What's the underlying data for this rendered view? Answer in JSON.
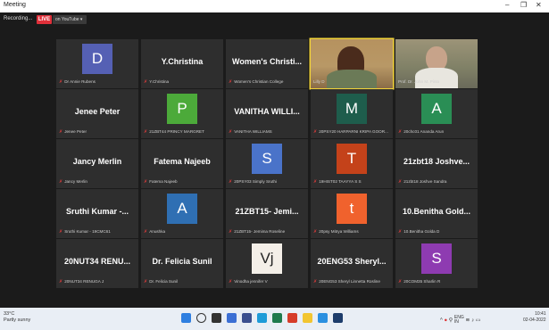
{
  "window": {
    "title": "Meeting"
  },
  "toolbar": {
    "recording_label": "Recording...",
    "live_label": "LIVE",
    "youtube_label": "on YouTube ▾"
  },
  "tiles": [
    {
      "avatar_letter": "D",
      "avatar_color": "#5560b4",
      "label": "Dr Annie Rubens",
      "muted": true
    },
    {
      "name": "Y.Christina",
      "label": "Y.Christina",
      "muted": true
    },
    {
      "name": "Women's Christi...",
      "label": "Women's Christian College",
      "muted": true
    },
    {
      "video": true,
      "label": "Lilly D",
      "active": true
    },
    {
      "video": true,
      "label": "Prof. Dr. John M. Pinto",
      "muted": false
    },
    {
      "name": "Jenee Peter",
      "label": "Jenee Peter",
      "muted": true
    },
    {
      "avatar_letter": "P",
      "avatar_color": "#4caa3a",
      "label": "21ZBT44 PRINCY MARGRET",
      "muted": true
    },
    {
      "name": "VANITHA WILLI...",
      "label": "VANITHA WILLIAMS",
      "muted": true
    },
    {
      "avatar_letter": "M",
      "avatar_color": "#1e5d4c",
      "label": "20PSY20 HARPARNI KRIPA GOOR...",
      "muted": true
    },
    {
      "avatar_letter": "A",
      "avatar_color": "#2a8e55",
      "label": "20chc01 Ananda Arun",
      "muted": true
    },
    {
      "name": "Jancy Merlin",
      "label": "Jancy Merlin",
      "muted": true
    },
    {
      "name": "Fatema Najeeb",
      "label": "Fatema Najeeb",
      "muted": true
    },
    {
      "avatar_letter": "S",
      "avatar_color": "#4a73c9",
      "label": "20PSY03 Simply Sruthi",
      "muted": true
    },
    {
      "avatar_letter": "T",
      "avatar_color": "#c4421a",
      "label": "19HIST02 TAAYYA S S",
      "muted": true
    },
    {
      "name": "21zbt18 Joshve...",
      "label": "21zbt18 Joshve Sandra",
      "muted": true
    },
    {
      "name": "Sruthi Kumar -...",
      "label": "Sruthi Kumar - 19CMC61",
      "muted": true
    },
    {
      "avatar_letter": "A",
      "avatar_color": "#2f6fb3",
      "label": "Anushka",
      "muted": true
    },
    {
      "name": "21ZBT15- Jemi...",
      "label": "21ZBT15- Jemima Roseline",
      "muted": true
    },
    {
      "avatar_letter": "t",
      "avatar_color": "#f0622d",
      "label": "20psy Mitrya Williams",
      "muted": true
    },
    {
      "name": "10.Benitha Gold...",
      "label": "10.Benitha Golda D",
      "muted": true
    },
    {
      "name": "20NUT34 RENU...",
      "label": "20NUT34 RENUGA J",
      "muted": true
    },
    {
      "name": "Dr. Felicia Sunil",
      "label": "Dr. Felicia Sunil",
      "muted": true
    },
    {
      "logo": true,
      "label": "Vinodha jennifer V",
      "muted": true
    },
    {
      "name": "20ENG53 Sheryl...",
      "label": "20ENG53 Sheryl Linnetta Rosline",
      "muted": true
    },
    {
      "avatar_letter": "S",
      "avatar_color": "#8e3bb1",
      "label": "20COM35 Sharlin R",
      "muted": true
    }
  ],
  "taskbar": {
    "weather_temp": "33°C",
    "weather_desc": "Partly sunny",
    "time": "10:41",
    "date": "02-04-2022",
    "lang": "ENG",
    "lang_region": "IN"
  }
}
